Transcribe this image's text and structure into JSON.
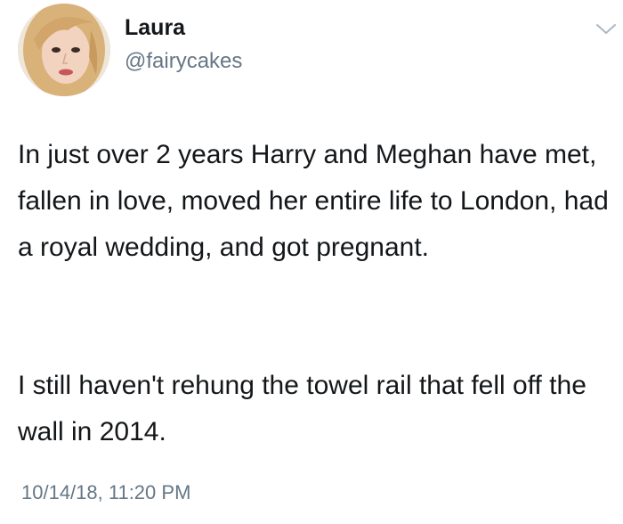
{
  "user": {
    "display_name": "Laura",
    "handle": "@fairycakes"
  },
  "icons": {
    "avatar": "avatar",
    "menu": "chevron-down-icon"
  },
  "tweet": {
    "paragraphs": [
      "In just over 2 years Harry and Meghan have met, fallen in love, moved her entire life to London, had a royal wedding, and got pregnant.",
      "I still haven't rehung the towel rail that fell off the wall in 2014."
    ],
    "timestamp": "10/14/18, 11:20 PM"
  },
  "colors": {
    "text": "#14171a",
    "secondary": "#657786",
    "background": "#ffffff"
  }
}
